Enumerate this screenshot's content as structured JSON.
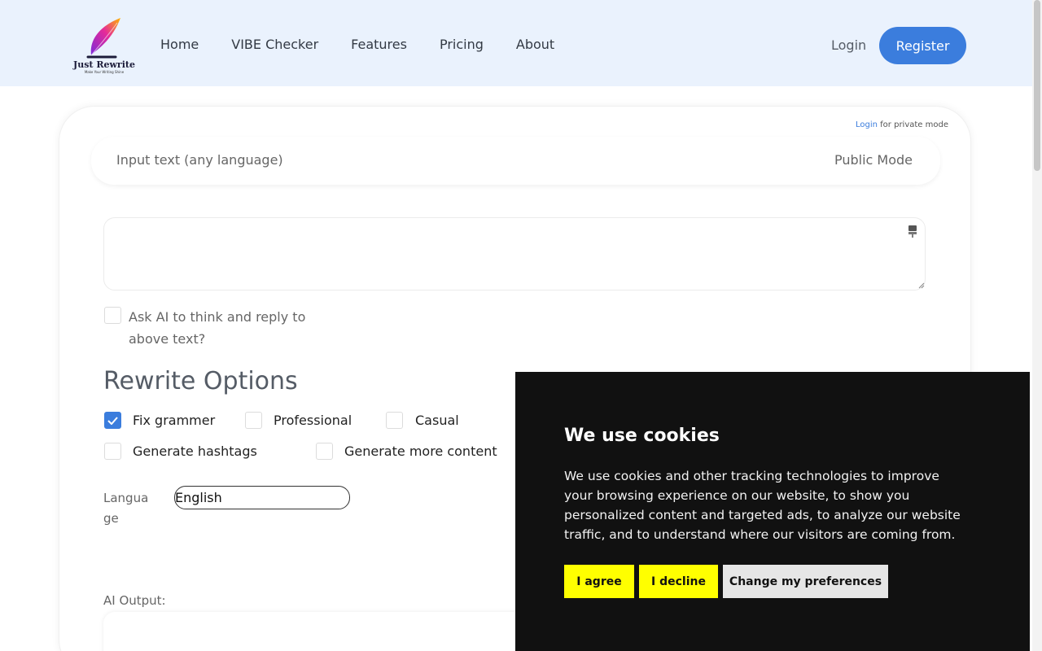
{
  "brand": {
    "name": "Just Rewrite",
    "tagline": "Make Your Writing Shine"
  },
  "nav": {
    "items": [
      "Home",
      "VIBE Checker",
      "Features",
      "Pricing",
      "About"
    ],
    "login": "Login",
    "register": "Register"
  },
  "editor": {
    "private_note_link": "Login",
    "private_note_text": " for private mode",
    "input_label": "Input text (any language)",
    "mode": "Public Mode",
    "textarea_value": "",
    "think_label": "Ask AI to think and reply to above text?",
    "think_checked": false
  },
  "rewrite": {
    "title": "Rewrite Options",
    "options": [
      {
        "label": "Fix grammer",
        "checked": true
      },
      {
        "label": "Professional",
        "checked": false
      },
      {
        "label": "Casual",
        "checked": false
      },
      {
        "label": "Generate hashtags",
        "checked": false
      },
      {
        "label": "Generate more content",
        "checked": false
      }
    ],
    "language_label": "Language",
    "language_value": "English",
    "output_label": "AI Output:"
  },
  "cookie": {
    "title": "We use cookies",
    "text": "We use cookies and other tracking technologies to improve your browsing experience on our website, to show you personalized content and targeted ads, to analyze our website traffic, and to understand where our visitors are coming from.",
    "agree": "I agree",
    "decline": "I decline",
    "preferences": "Change my preferences"
  },
  "colors": {
    "accent": "#3b7ddd",
    "header_bg": "#eaf2fd",
    "cookie_bg": "#111111",
    "cookie_button": "#ffff00"
  }
}
